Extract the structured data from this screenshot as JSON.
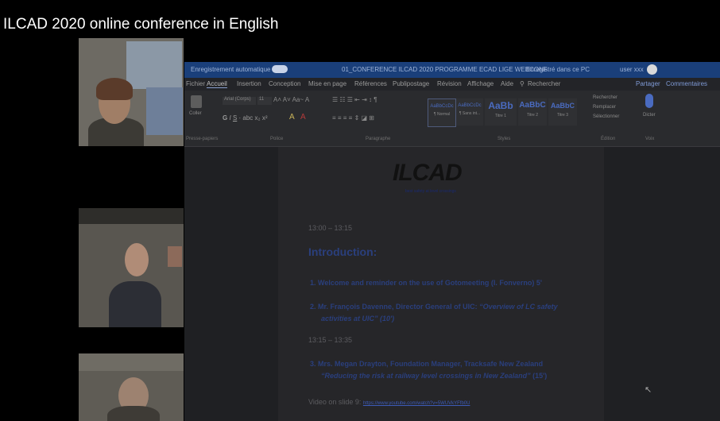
{
  "caption": "ILCAD 2020 online conference in English",
  "word": {
    "titlebar": {
      "autosave": "Enregistrement automatique",
      "filename": "01_CONFERENCE ILCAD 2020 PROGRAMME ECAD LIGE WEBCONF",
      "mode": "Enregistré dans ce PC",
      "user": "user xxx"
    },
    "tabs": [
      "Fichier",
      "Accueil",
      "Insertion",
      "Conception",
      "Mise en page",
      "Références",
      "Publipostage",
      "Révision",
      "Affichage",
      "Aide",
      "Rechercher"
    ],
    "right_actions": {
      "share": "Partager",
      "comments": "Commentaires"
    },
    "ribbon": {
      "paste_label": "Coller",
      "font_name": "Arial (Corps)",
      "font_size": "11",
      "group_clipboard": "Presse-papiers",
      "group_font": "Police",
      "group_paragraph": "Paragraphe",
      "group_styles": "Styles",
      "group_editing": "Édition",
      "group_voice": "Voix",
      "styles": [
        {
          "sample": "AaBbCcDc",
          "name": "¶ Normal"
        },
        {
          "sample": "AaBbCcDc",
          "name": "¶ Sans int..."
        },
        {
          "sample": "AaBb",
          "name": "Titre 1"
        },
        {
          "sample": "AaBbC",
          "name": "Titre 2"
        },
        {
          "sample": "AaBbC",
          "name": "Titre 3"
        }
      ],
      "edit_find": "Rechercher",
      "edit_replace": "Remplacer",
      "edit_select": "Sélectionner",
      "dictate": "Dicter"
    }
  },
  "doc": {
    "logo": "ILCAD",
    "tagline": "best safety at level crossings",
    "time1": "13:00 – 13:15",
    "heading": "Introduction:",
    "item1": "1. Welcome and reminder on the use of Gotomeeting (I. Fonverno) 5'",
    "item2_line1_a": "2. Mr. François Davenne, Director General of UIC: ",
    "item2_line1_b": "“Overview of LC safety",
    "item2_line2": "activities at UIC” (10')",
    "time2": "13:15 – 13:35",
    "item3_line1": "3. Mrs. Megan Drayton, Foundation Manager, Tracksafe New Zealand",
    "item3_line2_a": "“Reducing the risk at railway level crossings in New Zealand”",
    "item3_line2_b": " (15')",
    "video_label": "Video on slide 9: ",
    "video_link": "https://www.youtube.com/watch?v=5WUVkYFfb0U"
  }
}
